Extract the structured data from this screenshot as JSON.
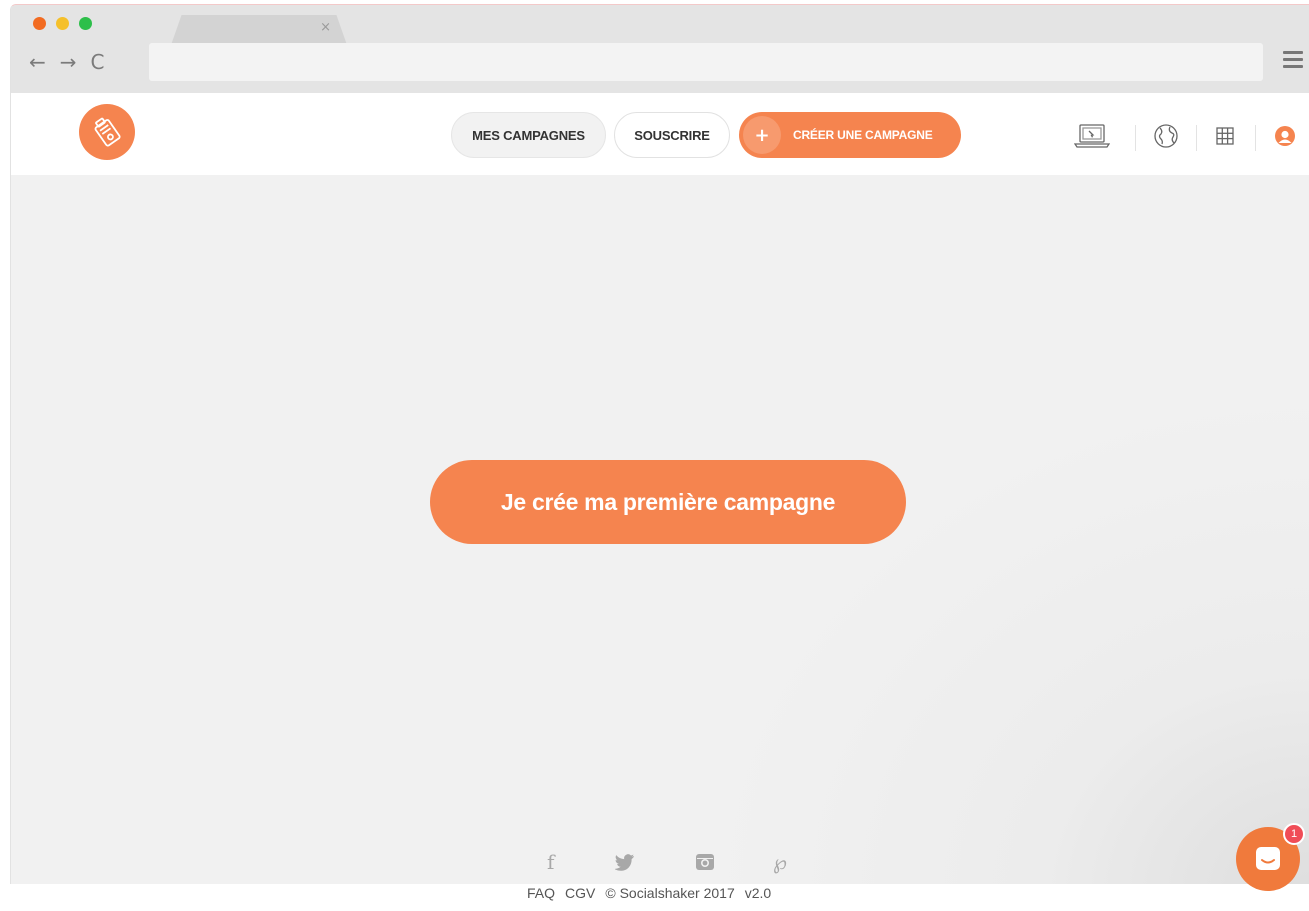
{
  "browser": {
    "tab_close": "×",
    "back": "←",
    "forward": "→",
    "reload": "C",
    "url": ""
  },
  "header": {
    "logo_icon": "tag-ticket-icon",
    "nav": {
      "campaigns_label": "MES CAMPAGNES",
      "subscribe_label": "SOUSCRIRE",
      "create_label": "CRÉER UNE CAMPAGNE",
      "create_icon": "+"
    },
    "icons": [
      "laptop-icon",
      "globe-icon",
      "grid-icon",
      "user-icon"
    ]
  },
  "main": {
    "cta_label": "Je crée ma première campagne"
  },
  "footer": {
    "socials": [
      "f",
      "𝕪",
      "◘",
      "℘"
    ],
    "links": [
      "FAQ",
      "CGV",
      "© Socialshaker 2017",
      "v2.0"
    ]
  },
  "chat": {
    "badge_count": "1"
  },
  "colors": {
    "accent": "#f5844f",
    "chat": "#f07a3c",
    "badge": "#f04d57"
  }
}
